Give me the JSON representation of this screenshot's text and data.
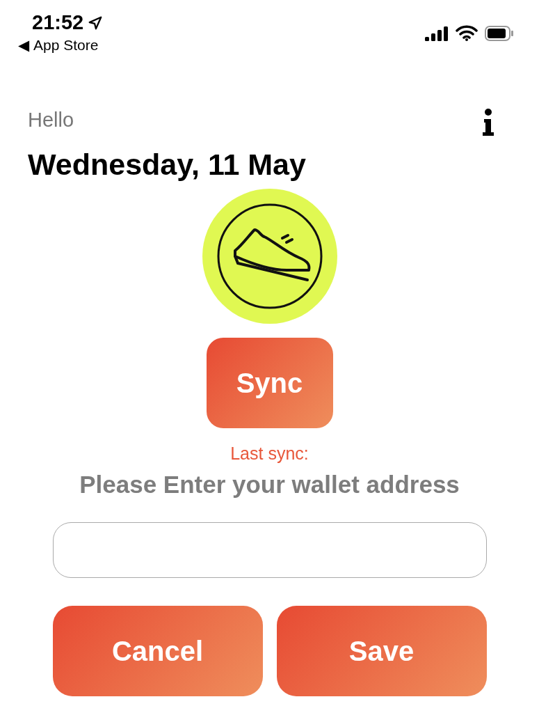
{
  "status_bar": {
    "time": "21:52",
    "back_arrow": "◀",
    "back_label": "App Store"
  },
  "header": {
    "greeting": "Hello",
    "date": "Wednesday, 11 May"
  },
  "sync": {
    "button": "Sync",
    "last_sync": "Last sync:"
  },
  "wallet": {
    "prompt": "Please Enter your wallet address"
  },
  "buttons": [
    {
      "label": "Cancel"
    },
    {
      "label": "Save"
    }
  ]
}
